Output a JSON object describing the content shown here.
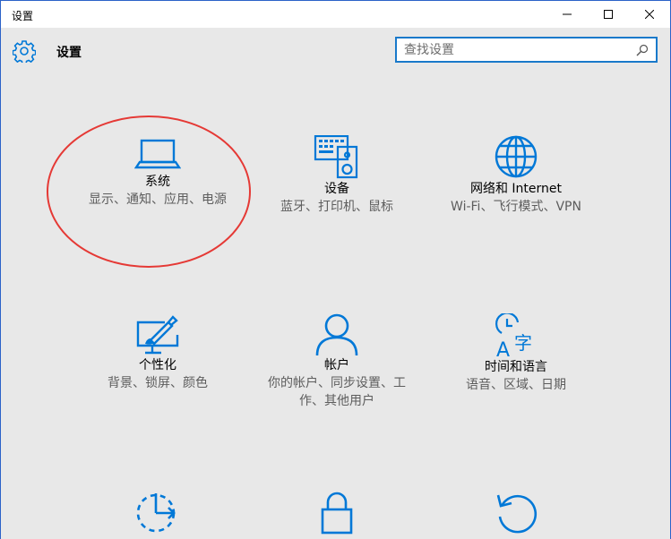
{
  "window": {
    "title": "设置",
    "controls": [
      "minimize",
      "maximize",
      "close"
    ]
  },
  "header": {
    "title": "设置",
    "icon": "gear-icon"
  },
  "search": {
    "placeholder": "查找设置",
    "icon": "search-icon"
  },
  "tiles": [
    {
      "icon": "laptop-icon",
      "title": "系统",
      "desc": "显示、通知、应用、电源"
    },
    {
      "icon": "devices-icon",
      "title": "设备",
      "desc": "蓝牙、打印机、鼠标"
    },
    {
      "icon": "globe-icon",
      "title": "网络和 Internet",
      "desc": "Wi-Fi、飞行模式、VPN"
    },
    {
      "icon": "personalization-icon",
      "title": "个性化",
      "desc": "背景、锁屏、颜色"
    },
    {
      "icon": "person-icon",
      "title": "帐户",
      "desc": "你的帐户、同步设置、工作、其他用户"
    },
    {
      "icon": "time-language-icon",
      "title": "时间和语言",
      "desc": "语音、区域、日期"
    },
    {
      "icon": "ease-of-access-icon",
      "title": "",
      "desc": ""
    },
    {
      "icon": "lock-icon",
      "title": "",
      "desc": ""
    },
    {
      "icon": "update-icon",
      "title": "",
      "desc": ""
    }
  ],
  "colors": {
    "accent": "#0078d7",
    "annotation": "#e53935",
    "background": "#e8e8e8"
  }
}
